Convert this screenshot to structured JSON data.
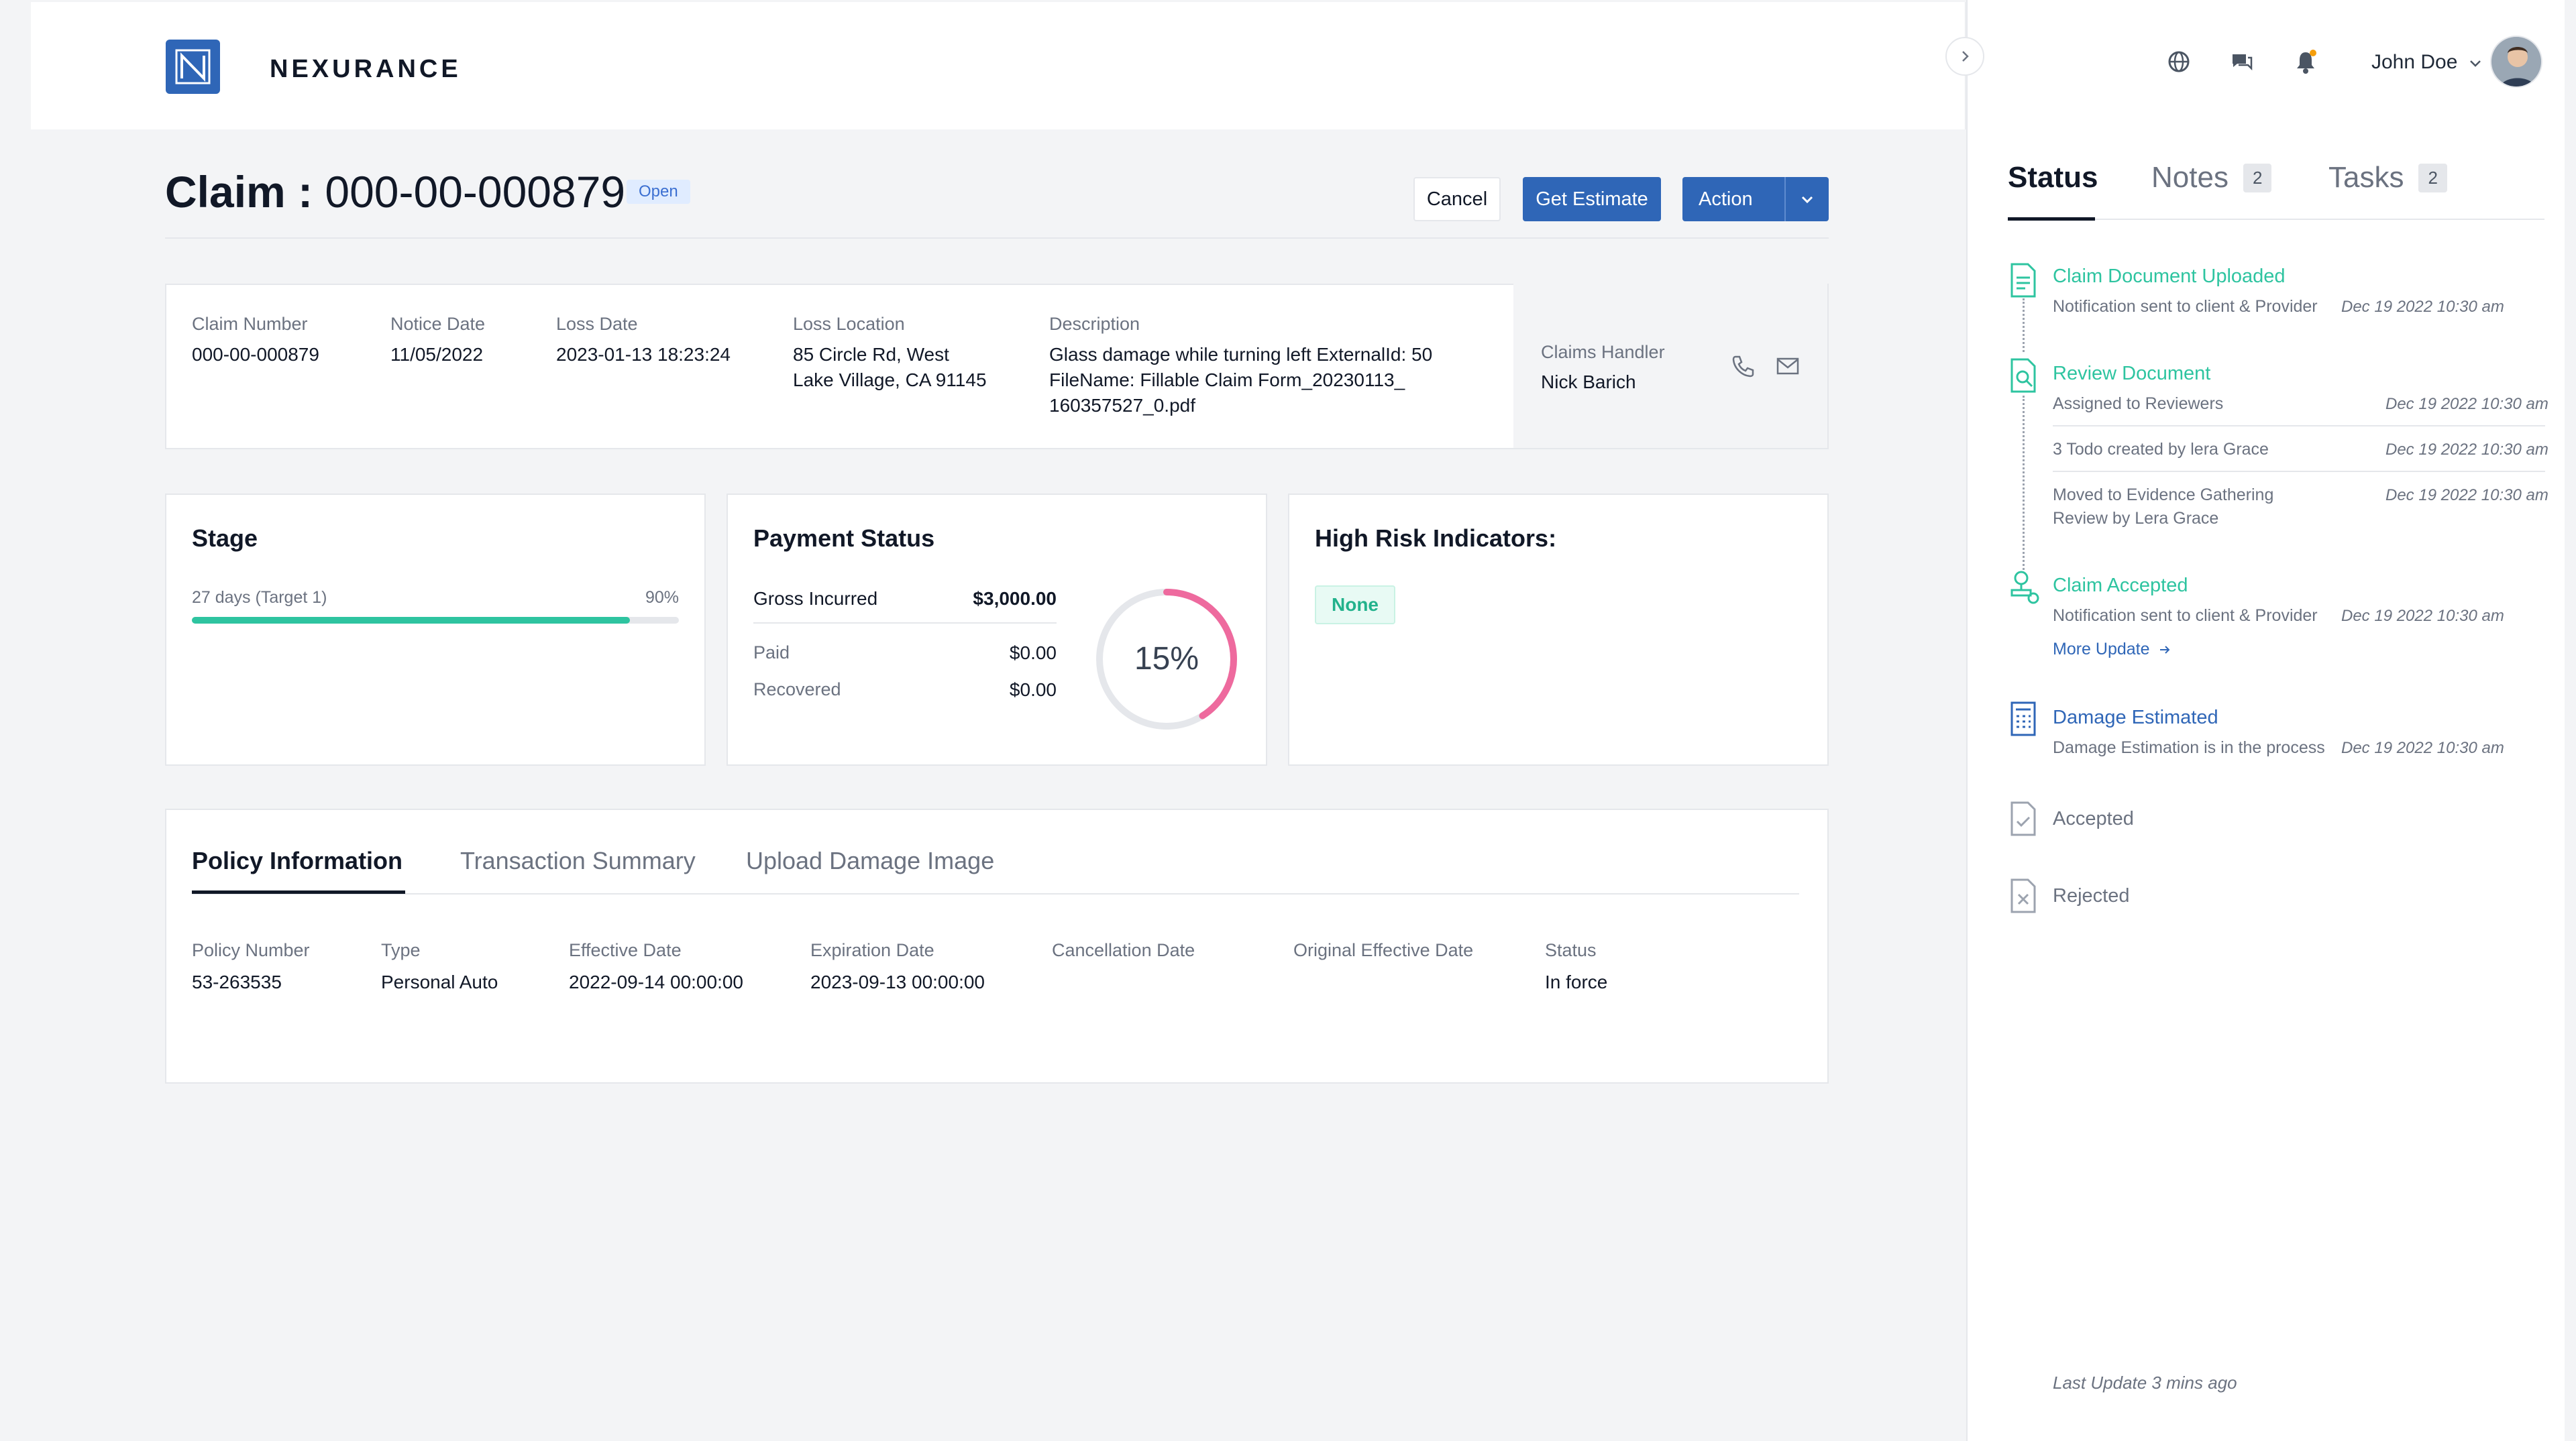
{
  "brand": {
    "name": "NEXURANCE",
    "color": "#2f66b7"
  },
  "header": {
    "user_name": "John Doe",
    "icons": [
      "globe-icon",
      "chat-icon",
      "bell-icon"
    ]
  },
  "claim": {
    "title_prefix": "Claim :",
    "number": "000-00-000879",
    "status_badge": "Open"
  },
  "actions": {
    "cancel": "Cancel",
    "get_estimate": "Get Estimate",
    "action": "Action"
  },
  "summary": {
    "claim_number_label": "Claim Number",
    "claim_number": "000-00-000879",
    "notice_date_label": "Notice Date",
    "notice_date": "11/05/2022",
    "loss_date_label": "Loss Date",
    "loss_date": "2023-01-13 18:23:24",
    "loss_location_label": "Loss Location",
    "loss_location_line1": "85 Circle Rd, West",
    "loss_location_line2": "Lake Village, CA 91145",
    "description_label": "Description",
    "description_line1": "Glass damage while turning left ExternalId: 50",
    "description_line2": "FileName: Fillable Claim Form_20230113_",
    "description_line3": "160357527_0.pdf",
    "handler_label": "Claims Handler",
    "handler_name": "Nick Barich"
  },
  "stage": {
    "title": "Stage",
    "days_text": "27 days (Target 1)",
    "percent_text": "90%",
    "progress": 0.9,
    "color": "#2ec4a0"
  },
  "payment": {
    "title": "Payment Status",
    "gross_label": "Gross Incurred",
    "gross_value": "$3,000.00",
    "paid_label": "Paid",
    "paid_value": "$0.00",
    "recovered_label": "Recovered",
    "recovered_value": "$0.00",
    "ring_text": "15%",
    "ring_fraction": 0.41,
    "ring_color": "#ee6a9e"
  },
  "risk": {
    "title": "High Risk Indicators:",
    "value": "None"
  },
  "tabs": {
    "policy": "Policy Information",
    "transaction": "Transaction Summary",
    "upload": "Upload Damage Image"
  },
  "policy": {
    "number_label": "Policy Number",
    "number": "53-263535",
    "type_label": "Type",
    "type": "Personal Auto",
    "effective_label": "Effective Date",
    "effective": "2022-09-14 00:00:00",
    "expiration_label": "Expiration Date",
    "expiration": "2023-09-13 00:00:00",
    "cancellation_label": "Cancellation Date",
    "original_label": "Original Effective Date",
    "status_label": "Status",
    "status": "In force"
  },
  "panel": {
    "tabs": {
      "status": "Status",
      "notes": "Notes",
      "notes_count": "2",
      "tasks": "Tasks",
      "tasks_count": "2"
    },
    "timeline": {
      "t1_title": "Claim Document Uploaded",
      "t1_sub": "Notification sent to client & Provider",
      "t1_time": "Dec 19 2022 10:30 am",
      "t2_title": "Review Document",
      "t2_sub": "Assigned to Reviewers",
      "t2_time": "Dec 19 2022 10:30 am",
      "t2b_sub": "3 Todo created by lera Grace",
      "t2b_time": "Dec 19 2022 10:30 am",
      "t2c_sub1": "Moved to Evidence Gathering",
      "t2c_sub2": "Review by Lera Grace",
      "t2c_time": "Dec 19 2022 10:30 am",
      "t3_title": "Claim Accepted",
      "t3_sub": "Notification sent to client & Provider",
      "t3_time": "Dec 19 2022 10:30 am",
      "t3_more": "More Update",
      "t4_title": "Damage Estimated",
      "t4_sub": "Damage Estimation is in the process",
      "t4_time": "Dec 19 2022 10:30 am",
      "t5_title": "Accepted",
      "t6_title": "Rejected"
    },
    "last_update": "Last Update 3 mins ago",
    "colors": {
      "done": "#2ec4a0",
      "active": "#2f66b7",
      "pending": "#9ca3af"
    }
  }
}
